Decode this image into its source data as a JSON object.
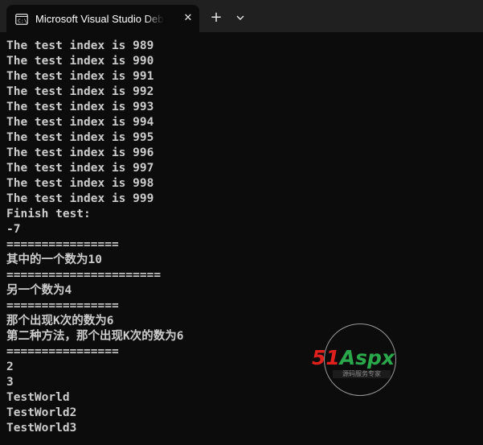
{
  "window": {
    "tab_title": "Microsoft Visual Studio Debug Console",
    "tab_icon": "console-app-icon",
    "close_glyph": "✕",
    "new_tab_glyph": "+",
    "dropdown_icon": "chevron-down-icon"
  },
  "console": {
    "lines": [
      "The test index is 989",
      "The test index is 990",
      "The test index is 991",
      "The test index is 992",
      "The test index is 993",
      "The test index is 994",
      "The test index is 995",
      "The test index is 996",
      "The test index is 997",
      "The test index is 998",
      "The test index is 999",
      "Finish test:",
      "-7",
      "================",
      "其中的一个数为10",
      "======================",
      "另一个数为4",
      "================",
      "那个出现K次的数为6",
      "第二种方法，那个出现K次的数为6",
      "================",
      "2",
      "3",
      "TestWorld",
      "TestWorld2",
      "TestWorld3"
    ]
  },
  "watermark": {
    "brand_red": "51",
    "brand_green": "Aspx",
    "subtitle": "源码服务专家"
  },
  "colors": {
    "background": "#0c0c0c",
    "titlebar": "#202020",
    "text": "#cccccc",
    "brand_red": "#e0201c",
    "brand_green": "#2aa74a"
  }
}
